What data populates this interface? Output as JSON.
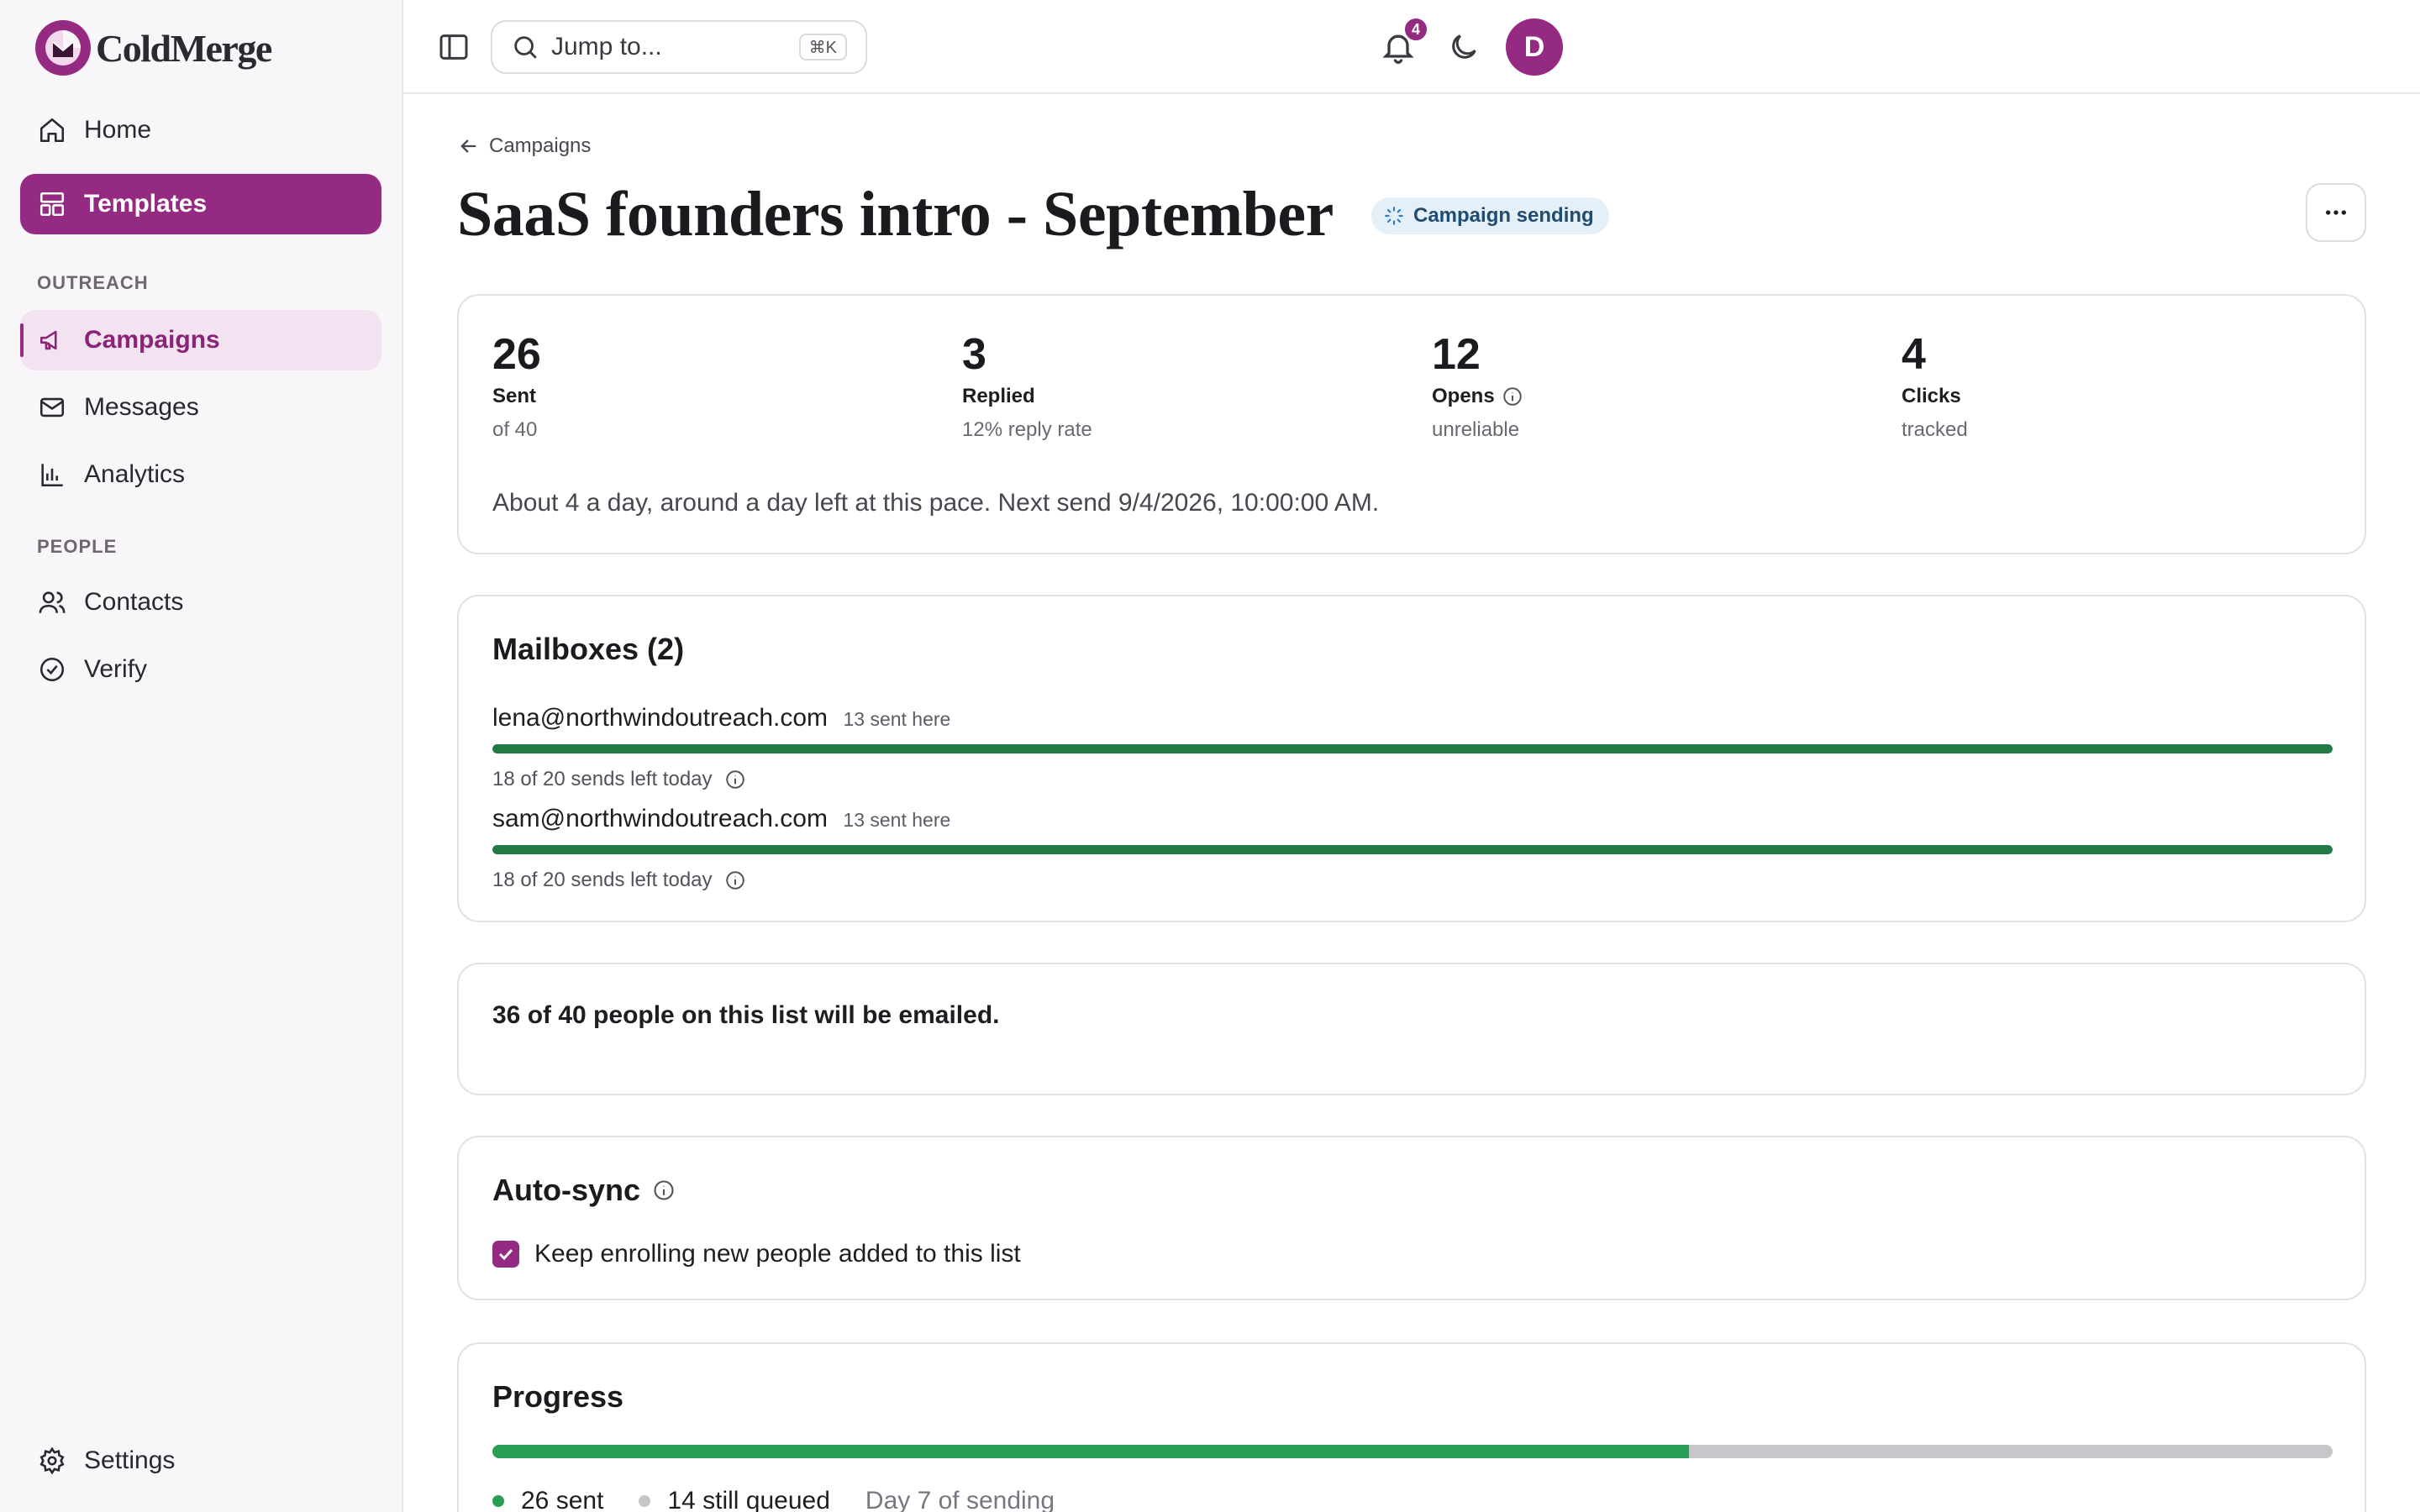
{
  "brand": {
    "name": "ColdMerge",
    "color": "#952a83"
  },
  "sidebar": {
    "home": "Home",
    "templates": "Templates",
    "outreach_label": "OUTREACH",
    "campaigns": "Campaigns",
    "messages": "Messages",
    "analytics": "Analytics",
    "people_label": "PEOPLE",
    "contacts": "Contacts",
    "verify": "Verify",
    "settings": "Settings"
  },
  "topbar": {
    "search_placeholder": "Jump to...",
    "shortcut": "⌘K",
    "notification_count": "4",
    "avatar_initial": "D"
  },
  "page": {
    "back_label": "Campaigns",
    "title": "SaaS founders intro - September",
    "status": "Campaign sending"
  },
  "stats": [
    {
      "value": "26",
      "label": "Sent",
      "sub": "of 40"
    },
    {
      "value": "3",
      "label": "Replied",
      "sub": "12% reply rate"
    },
    {
      "value": "12",
      "label": "Opens",
      "sub": "unreliable"
    },
    {
      "value": "4",
      "label": "Clicks",
      "sub": "tracked"
    }
  ],
  "pace_text": "About 4 a day, around a day left at this pace. Next send 9/4/2026, 10:00:00 AM.",
  "mailboxes": {
    "title": "Mailboxes (2)",
    "items": [
      {
        "email": "lena@northwindoutreach.com",
        "sent": "13 sent here",
        "left": "18 of 20 sends left today",
        "fraction": 1.0
      },
      {
        "email": "sam@northwindoutreach.com",
        "sent": "13 sent here",
        "left": "18 of 20 sends left today",
        "fraction": 1.0
      }
    ]
  },
  "enroll_text": "36 of 40 people on this list will be emailed.",
  "autosync": {
    "title": "Auto-sync",
    "checkbox_label": "Keep enrolling new people added to this list",
    "checked": true
  },
  "progress": {
    "title": "Progress",
    "sent_fraction": 0.65,
    "sent_label": "26 sent",
    "queued_label": "14 still queued",
    "day_label": "Day 7 of sending",
    "sent_color": "#2a9d55",
    "queued_color": "#c9c6cb"
  }
}
